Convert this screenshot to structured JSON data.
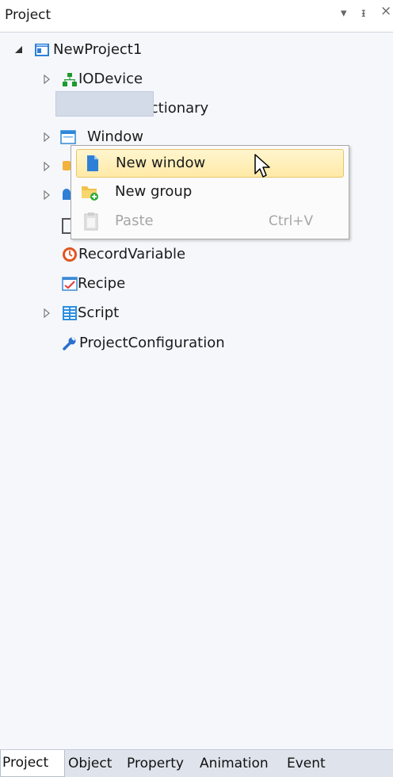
{
  "panel": {
    "title": "Project",
    "controls": {
      "dropdown": "▾",
      "pin": "ᵻ",
      "close": "×"
    }
  },
  "tree": {
    "root": "NewProject1",
    "items": [
      {
        "label": "IODevice",
        "icon": "network-icon"
      },
      {
        "label": "VariableDictionary",
        "icon": "jar-icon"
      },
      {
        "label": "Window",
        "icon": "window-icon"
      },
      {
        "label": "RecordVariable",
        "icon": "clock-icon"
      },
      {
        "label": "Recipe",
        "icon": "recipe-icon"
      },
      {
        "label": "Script",
        "icon": "script-icon"
      },
      {
        "label": "ProjectConfiguration",
        "icon": "wrench-icon"
      }
    ]
  },
  "context_menu": {
    "items": [
      {
        "label": "New window",
        "icon": "new-window-icon",
        "highlighted": true
      },
      {
        "label": "New group",
        "icon": "folder-icon"
      },
      {
        "label": "Paste",
        "icon": "paste-icon",
        "shortcut": "Ctrl+V",
        "disabled": true
      }
    ]
  },
  "tabs": [
    "Project",
    "Object",
    "Property",
    "Animation",
    "Event"
  ],
  "colors": {
    "highlight": "#ffe9a6",
    "selection": "#d3dbe8",
    "panel_bg": "#f5f7fb"
  }
}
